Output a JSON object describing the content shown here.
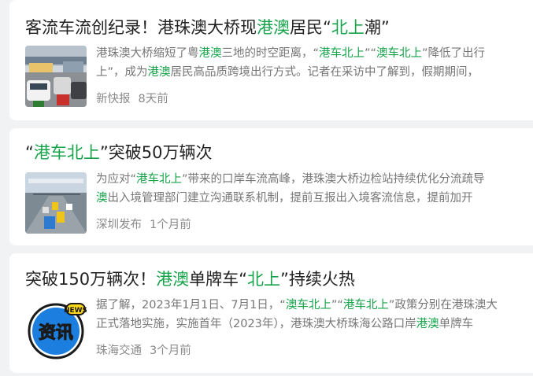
{
  "articles": [
    {
      "title": {
        "p1": "客流车流创纪录！港珠澳大桥现",
        "h1": "港澳",
        "p2": "居民“",
        "h2": "北上",
        "p3": "潮”"
      },
      "snippet": {
        "line1": {
          "p1": "港珠澳大桥缩短了粤",
          "h1": "港澳",
          "p2": "三地的时空距离，“",
          "h2": "港车北上",
          "p3": "”“",
          "h3": "澳车北上",
          "p4": "”降低了出行"
        },
        "line2": {
          "p1": "上”，成为",
          "h1": "港澳",
          "p2": "居民高品质跨境出行方式。记者在采访中了解到，假期期间，"
        }
      },
      "source": "新快报",
      "time": "8天前",
      "thumb_icon": "traffic-photo"
    },
    {
      "title": {
        "p1": "“",
        "h1": "港车北上",
        "p2": "”突破50万辆次"
      },
      "snippet": {
        "line1": {
          "p1": "为应对“",
          "h1": "港车北上",
          "p2": "”带来的口岸车流高峰，港珠澳大桥边检站持续优化分流疏导"
        },
        "line2": {
          "h1": "澳",
          "p1": "出入境管理部门建立沟通联系机制，提前互报出入境客流信息，提前加开"
        }
      },
      "source": "深圳发布",
      "time": "1个月前",
      "thumb_icon": "bridge-road-photo"
    },
    {
      "title": {
        "p1": "突破150万辆次！",
        "h1": "港澳",
        "p2": "单牌车“",
        "h2": "北上",
        "p3": "”持续火热"
      },
      "snippet": {
        "line1": {
          "p1": "据了解，2023年1月1日、7月1日，“",
          "h1": "澳车北上",
          "p2": "”“",
          "h2": "港车北上",
          "p3": "”政策分别在港珠澳大"
        },
        "line2": {
          "p1": "正式落地实施，实施首年（2023年），港珠澳大桥珠海公路口岸",
          "h1": "港澳",
          "p2": "单牌车"
        }
      },
      "source": "珠海交通",
      "time": "3个月前",
      "thumb_icon": "news-badge",
      "badge": {
        "main": "资讯",
        "small": "NEWS"
      }
    }
  ],
  "colors": {
    "highlight": "#16a34a",
    "badge_blue": "#1c7fe0",
    "badge_yellow": "#ffd91a"
  }
}
